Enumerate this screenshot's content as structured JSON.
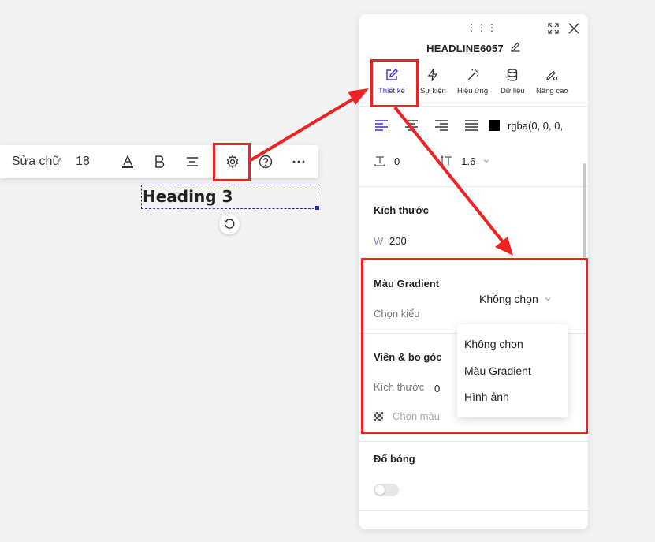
{
  "toolbar": {
    "edit_text_label": "Sửa chữ",
    "font_size": "18"
  },
  "canvas": {
    "heading_text": "Heading 3"
  },
  "panel": {
    "title": "HEADLINE6057",
    "tabs": [
      {
        "label": "Thiết kế",
        "icon": "edit-icon"
      },
      {
        "label": "Sự kiện",
        "icon": "bolt-icon"
      },
      {
        "label": "Hiệu ứng",
        "icon": "magic-wand-icon"
      },
      {
        "label": "Dữ liệu",
        "icon": "database-icon"
      },
      {
        "label": "Nâng cao",
        "icon": "advanced-settings-icon"
      }
    ],
    "text_color": "rgba(0, 0, 0,",
    "letter_spacing": "0",
    "line_height": "1.6",
    "size_section": {
      "title": "Kích thước",
      "width_label": "W",
      "width_value": "200"
    },
    "gradient_section": {
      "title": "Màu Gradient",
      "choose_style_label": "Chọn kiểu",
      "selected": "Không chọn"
    },
    "border_section": {
      "title": "Viền & bo góc",
      "size_label": "Kích thước",
      "size_value": "0",
      "color_label": "Chọn màu"
    },
    "shadow_section": {
      "title": "Đổ bóng"
    }
  },
  "dropdown": {
    "options": [
      "Không chọn",
      "Màu Gradient",
      "Hình ảnh"
    ]
  },
  "colors": {
    "accent": "#3b2fc9",
    "annotation": "#e22222"
  }
}
